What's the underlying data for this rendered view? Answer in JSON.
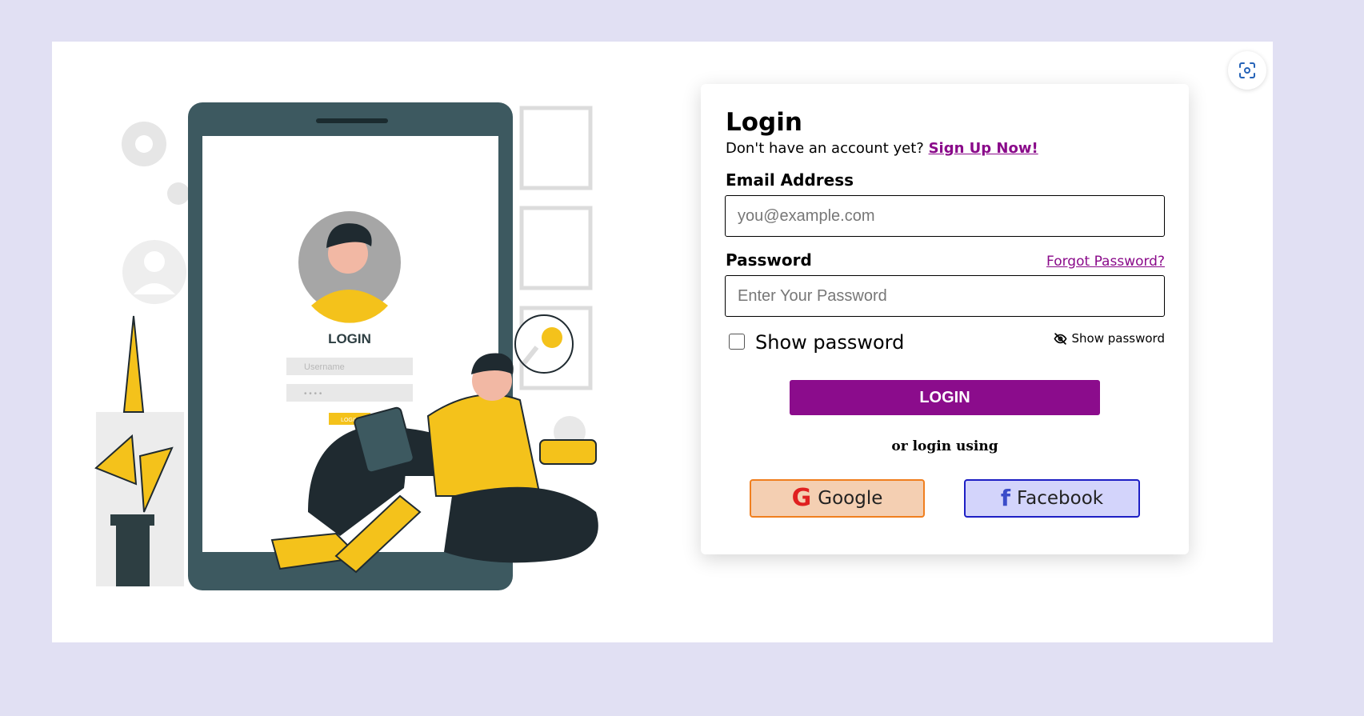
{
  "login": {
    "title": "Login",
    "signup_prompt": "Don't have an account yet?",
    "signup_link": "Sign Up Now!",
    "email_label": "Email Address",
    "email_placeholder": "you@example.com",
    "password_label": "Password",
    "forgot_link": "Forgot Password?",
    "password_placeholder": "Enter Your Password",
    "show_password_checkbox_label": "Show password",
    "show_password_toggle_label": "Show password",
    "login_button": "LOGIN",
    "or_text": "or login using",
    "google_button": "Google",
    "facebook_button": "Facebook"
  },
  "illustration": {
    "phone_login_label": "LOGIN",
    "username_placeholder": "Username",
    "password_dots": "• • • •",
    "phone_button": "LOGIN"
  },
  "colors": {
    "background": "#e1e0f3",
    "accent_purple": "#8b0c8c",
    "google_bg": "#f4cfb2",
    "google_border": "#f07f1f",
    "facebook_bg": "#d3d4fb",
    "facebook_border": "#1d1fc4",
    "illustration_yellow": "#f4c21b",
    "illustration_phone": "#3d5960"
  },
  "icons": {
    "scan": "scan-icon",
    "eye_off": "eye-off-icon",
    "google": "google-g-icon",
    "facebook": "facebook-f-icon"
  }
}
